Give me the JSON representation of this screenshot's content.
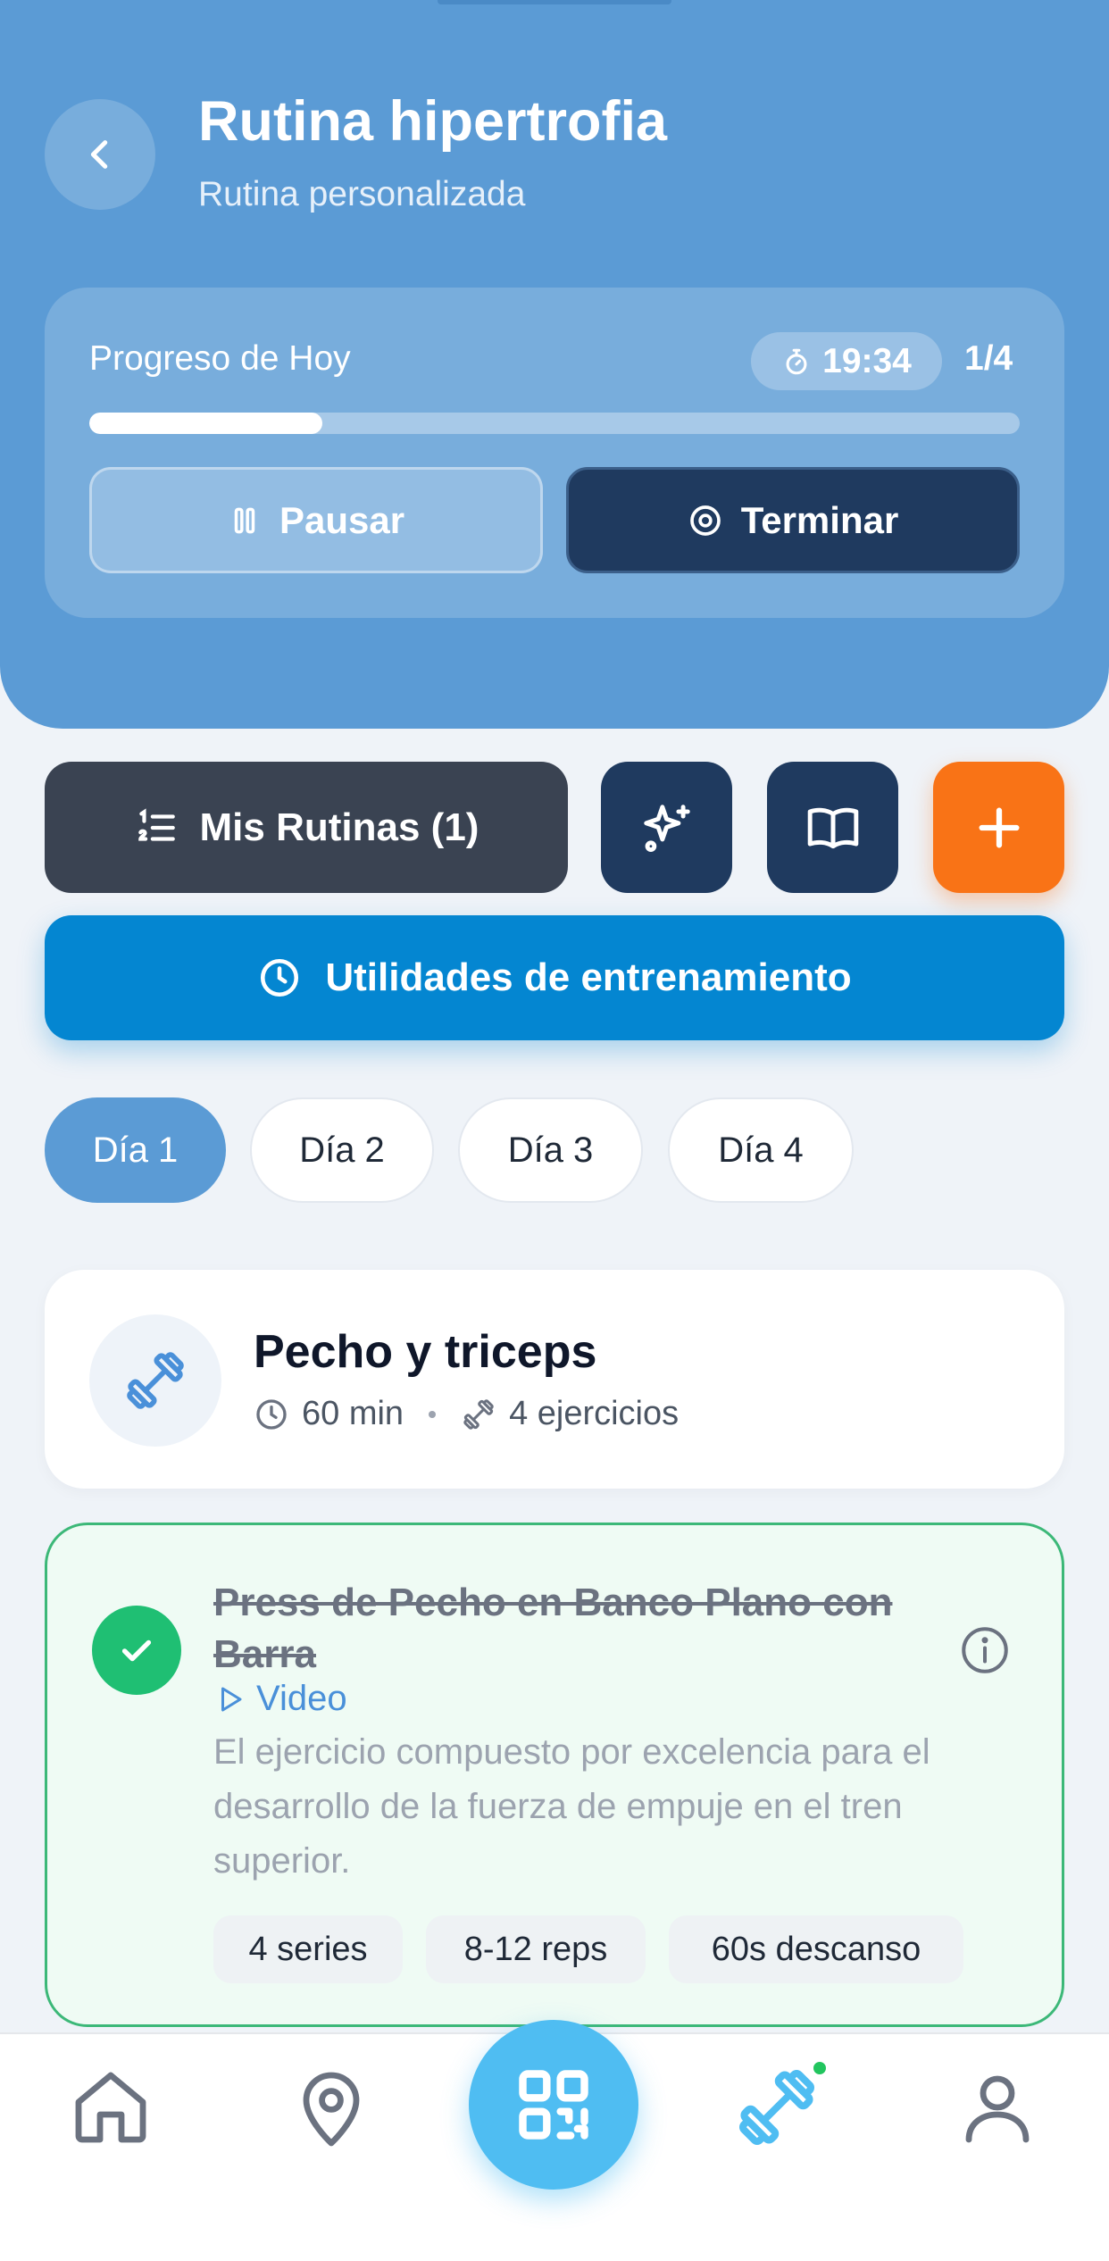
{
  "header": {
    "title": "Rutina hipertrofia",
    "subtitle": "Rutina personalizada"
  },
  "progress": {
    "label": "Progreso de Hoy",
    "timer": "19:34",
    "count": "1/4",
    "fraction": 0.25,
    "pause_label": "Pausar",
    "end_label": "Terminar"
  },
  "actions": {
    "routines_label": "Mis Rutinas (1)",
    "utilities_label": "Utilidades de entrenamiento"
  },
  "days": [
    "Día 1",
    "Día 2",
    "Día 3",
    "Día 4"
  ],
  "active_day": 0,
  "workout": {
    "title": "Pecho y triceps",
    "duration": "60 min",
    "exercises": "4 ejercicios"
  },
  "exercise": {
    "title": "Press de Pecho en Banco Plano con Barra",
    "video_label": "Video",
    "description": "El ejercicio compuesto por excelencia para el desarrollo de la fuerza de empuje en el tren superior.",
    "tags": [
      "4 series",
      "8-12 reps",
      "60s descanso"
    ],
    "completed": true
  },
  "colors": {
    "header": "#5b9bd5",
    "dark_navy": "#1f3a5f",
    "orange": "#f97316",
    "utility_blue": "#0486d1",
    "success_green": "#1fbf73",
    "qr_blue": "#4fbdf2"
  },
  "icons": {
    "back": "chevron-left-icon",
    "timer": "stopwatch-icon",
    "pause": "pause-icon",
    "stop": "stop-circle-icon",
    "list": "numbered-list-icon",
    "ai": "sparkles-icon",
    "book": "book-open-icon",
    "add": "plus-icon",
    "clock": "clock-icon",
    "dumbbell": "dumbbell-icon",
    "check": "check-icon",
    "info": "info-icon",
    "play": "play-icon",
    "nav": [
      "home-icon",
      "map-pin-icon",
      "qr-code-icon",
      "dumbbell-icon",
      "user-icon"
    ]
  }
}
